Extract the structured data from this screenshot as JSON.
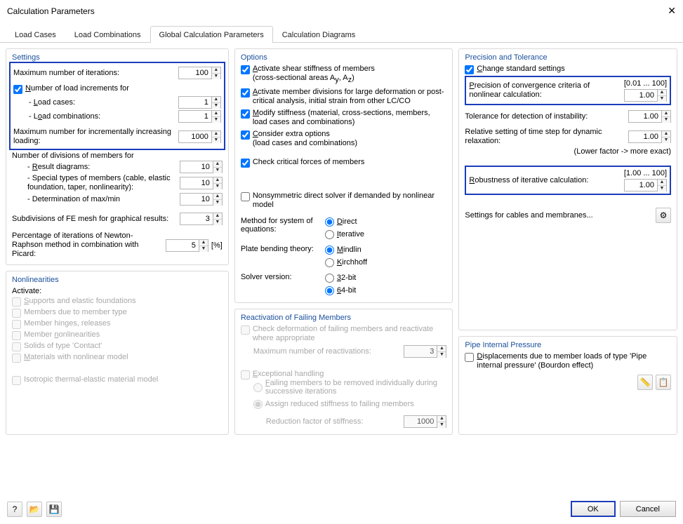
{
  "window": {
    "title": "Calculation Parameters"
  },
  "tabs": [
    "Load Cases",
    "Load Combinations",
    "Global Calculation Parameters",
    "Calculation Diagrams"
  ],
  "activeTab": 2,
  "settings": {
    "title": "Settings",
    "maxIter": {
      "label": "Maximum number of iterations:",
      "value": "100"
    },
    "numLoadInc": "Number of load increments for",
    "loadCases": {
      "label": "- Load cases:",
      "value": "1"
    },
    "loadCombos": {
      "label": "- Load combinations:",
      "value": "1"
    },
    "maxIncr": {
      "label": "Maximum number for incrementally increasing loading:",
      "value": "1000"
    },
    "divHeader": "Number of divisions of members for",
    "resultDiagrams": {
      "label": "- Result diagrams:",
      "value": "10"
    },
    "specialTypes": {
      "label": "- Special types of members (cable, elastic foundation, taper, nonlinearity):",
      "value": "10"
    },
    "maxmin": {
      "label": "- Determination of max/min",
      "value": "10"
    },
    "subdiv": {
      "label": "Subdivisions of FE mesh for graphical results:",
      "value": "3"
    },
    "picard": {
      "label": "Percentage of iterations of Newton-Raphson method in combination with Picard:",
      "value": "5",
      "unit": "[%]"
    }
  },
  "options": {
    "title": "Options",
    "shear": "Activate shear stiffness of members (cross-sectional areas Aᵧ, A_z)",
    "memDiv": "Activate member divisions for large deformation or post-critical analysis, initial strain from other LC/CO",
    "modStiff": "Modify stiffness (material, cross-sections, members, load cases and combinations)",
    "extra": "Consider extra options (load cases and combinations)",
    "critical": "Check critical forces of members",
    "nonsym": "Nonsymmetric direct solver if demanded by nonlinear model",
    "methodLabel": "Method for system of equations:",
    "direct": "Direct",
    "iterative": "Iterative",
    "plateLabel": "Plate bending theory:",
    "mindlin": "Mindlin",
    "kirchhoff": "Kirchhoff",
    "solverLabel": "Solver version:",
    "b32": "32-bit",
    "b64": "64-bit"
  },
  "precision": {
    "title": "Precision and Tolerance",
    "change": "Change standard settings",
    "conv": {
      "label": "Precision of convergence criteria of nonlinear calculation:",
      "range": "[0.01 ... 100]",
      "value": "1.00"
    },
    "instab": {
      "label": "Tolerance for detection of instability:",
      "value": "1.00"
    },
    "relax": {
      "label": "Relative setting of time step for dynamic relaxation:",
      "value": "1.00",
      "note": "(Lower factor -> more exact)"
    },
    "robust": {
      "label": "Robustness of iterative calculation:",
      "range": "[1.00 ... 100]",
      "value": "1.00"
    },
    "cablesLink": "Settings for cables and membranes..."
  },
  "nonlin": {
    "title": "Nonlinearities",
    "activate": "Activate:",
    "items": [
      "Supports and elastic foundations",
      "Members due to member type",
      "Member hinges, releases",
      "Member nonlinearities",
      "Solids of type 'Contact'",
      "Materials with nonlinear model"
    ],
    "iso": "Isotropic thermal-elastic material model"
  },
  "react": {
    "title": "Reactivation of Failing Members",
    "check": "Check deformation of failing members and reactivate where appropriate",
    "maxReact": {
      "label": "Maximum number of reactivations:",
      "value": "3"
    },
    "exc": "Exceptional handling",
    "opt1": "Failing members to be removed individually during successive iterations",
    "opt2": "Assign reduced stiffness to failing members",
    "redFactor": {
      "label": "Reduction factor of stiffness:",
      "value": "1000"
    }
  },
  "pipe": {
    "title": "Pipe Internal Pressure",
    "disp": "Displacements due to member loads of type 'Pipe internal pressure' (Bourdon effect)"
  },
  "buttons": {
    "ok": "OK",
    "cancel": "Cancel"
  }
}
